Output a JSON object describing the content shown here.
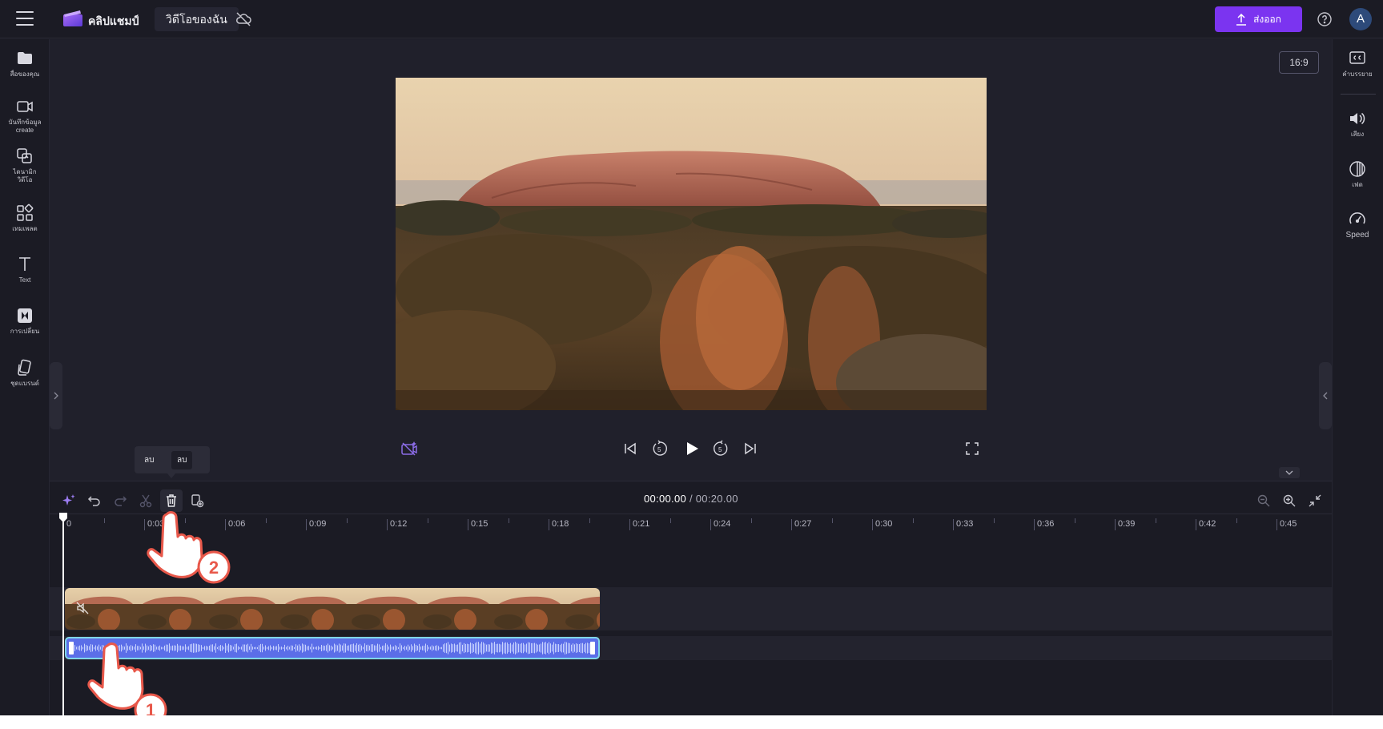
{
  "topbar": {
    "app_name": "คลิปแชมป์",
    "project_title": "วิดีโอของฉัน",
    "export_label": "ส่งออก",
    "avatar_initial": "A"
  },
  "left_sidebar": {
    "items": [
      {
        "icon": "folder-icon",
        "label": "สื่อของคุณ"
      },
      {
        "icon": "camera-icon",
        "label": "บันทึกข้อมูล",
        "sublabel": "create"
      },
      {
        "icon": "templates-icon",
        "label": "ไดนามิก",
        "sublabel": "วิดีโอ"
      },
      {
        "icon": "grid-icon",
        "label": "เทมเพลต"
      },
      {
        "icon": "text-icon",
        "label": "Text"
      },
      {
        "icon": "transitions-icon",
        "label": "การเปลี่ยน"
      },
      {
        "icon": "brand-kit-icon",
        "label": "ชุดแบรนด์"
      }
    ]
  },
  "right_sidebar": {
    "items": [
      {
        "icon": "captions-icon",
        "label": "คำบรรยาย"
      },
      {
        "icon": "audio-icon",
        "label": "เสียง"
      },
      {
        "icon": "fade-icon",
        "label": "เฟด"
      },
      {
        "icon": "speed-icon",
        "label": "Speed"
      }
    ]
  },
  "stage": {
    "aspect_ratio": "16:9"
  },
  "timeline": {
    "current_time": "00:00.00",
    "separator": "/",
    "total_time": "00:20.00",
    "ruler_labels": [
      "0",
      "0:03",
      "0:06",
      "0:09",
      "0:12",
      "0:15",
      "0:18",
      "0:21",
      "0:24",
      "0:27",
      "0:30",
      "0:33",
      "0:36",
      "0:39",
      "0:42",
      "0:45"
    ],
    "tooltip": {
      "item1": "ลบ",
      "item2": "ลบ"
    }
  },
  "annotations": {
    "step1": "1",
    "step2": "2"
  },
  "colors": {
    "accent": "#7b34f0",
    "audio_clip": "#5b6ee8",
    "audio_border": "#7fd6e8",
    "app_bg": "#1b1b24",
    "hand_outline": "#e8584a"
  }
}
